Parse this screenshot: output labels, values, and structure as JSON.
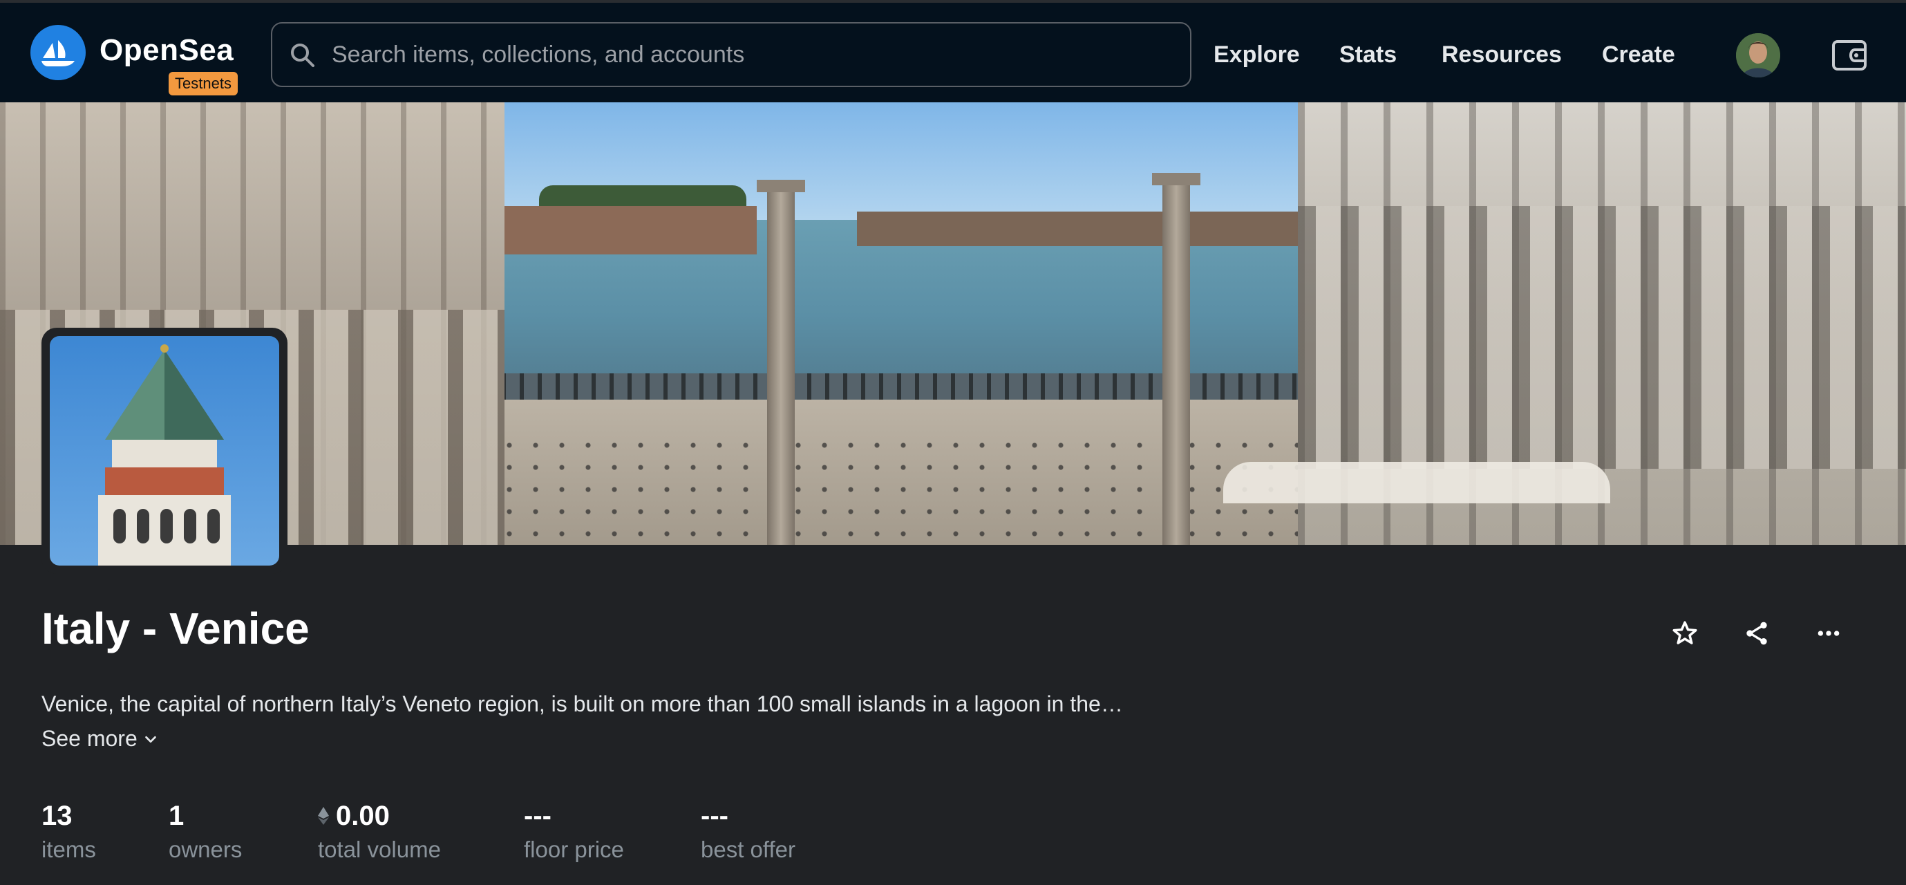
{
  "header": {
    "brand": "OpenSea",
    "badge": "Testnets",
    "search_placeholder": "Search items, collections, and accounts",
    "nav": [
      "Explore",
      "Stats",
      "Resources",
      "Create"
    ]
  },
  "collection": {
    "title": "Italy - Venice",
    "description": "Venice, the capital of northern Italy’s Veneto region, is built on more than 100 small islands in a lagoon in the…",
    "see_more": "See more"
  },
  "stats": [
    {
      "value": "13",
      "label": "items"
    },
    {
      "value": "1",
      "label": "owners"
    },
    {
      "value": "0.00",
      "label": "total volume",
      "icon": "eth-icon"
    },
    {
      "value": "---",
      "label": "floor price"
    },
    {
      "value": "---",
      "label": "best offer"
    }
  ],
  "colors": {
    "header_bg": "#04111d",
    "page_bg": "#202225",
    "brand_blue": "#2081e2",
    "badge_orange": "#f3993f",
    "muted_text": "#8a939b"
  }
}
